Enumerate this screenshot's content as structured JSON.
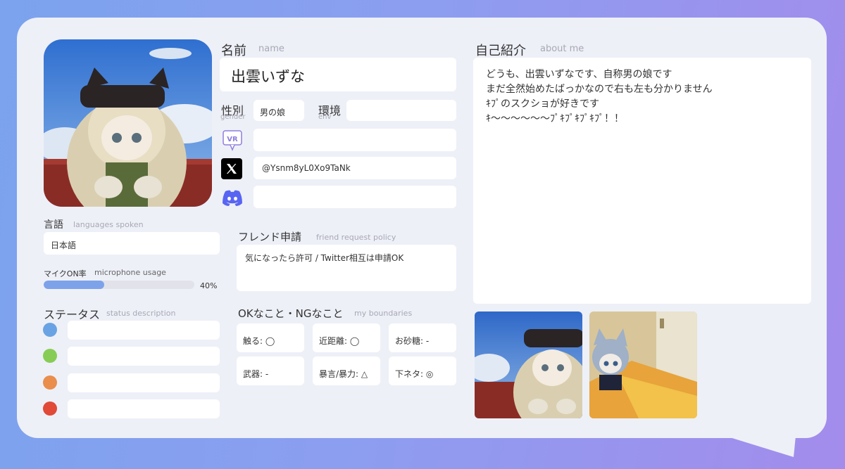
{
  "profile": {
    "name_label": "名前",
    "name_sub": "name",
    "name_value": "出雲いずな",
    "gender_label": "性別",
    "gender_sub": "gender",
    "gender_value": "男の娘",
    "env_label": "環境",
    "env_sub": "env",
    "env_value": "",
    "vrchat_value": "",
    "x_value": "@Ysnm8yL0Xo9TaNk",
    "discord_value": ""
  },
  "languages": {
    "label": "言語",
    "sub": "languages spoken",
    "value": "日本語"
  },
  "mic": {
    "label": "マイクON率",
    "sub": "microphone usage",
    "percent_text": "40%",
    "percent": 40
  },
  "status": {
    "label": "ステータス",
    "sub": "status description",
    "items": [
      {
        "color": "#6aa3e4",
        "text": ""
      },
      {
        "color": "#87cd55",
        "text": ""
      },
      {
        "color": "#e98e4d",
        "text": ""
      },
      {
        "color": "#e04a37",
        "text": ""
      }
    ]
  },
  "friend": {
    "label": "フレンド申請",
    "sub": "friend request policy",
    "value": "気になったら許可 / Twitter相互は申請OK"
  },
  "boundaries": {
    "label": "OKなこと・NGなこと",
    "sub": "my boundaries",
    "items": [
      "触る: ◯",
      "近距離: ◯",
      "お砂糖: -",
      "武器: -",
      "暴言/暴力: △",
      "下ネタ: ◎"
    ]
  },
  "about": {
    "label": "自己紹介",
    "sub": "about me",
    "lines": [
      "どうも、出雲いずなです、自称男の娘です",
      "まだ全然始めたばっかなので右も左も分かりません",
      "ｷﾌﾟのスクショが好きです",
      "ｷ〜〜〜〜〜〜ﾌﾟｷﾌﾟｷﾌﾟｷﾌﾟ！！"
    ]
  },
  "colors": {
    "accent": "#7ea2ea",
    "card": "#eef0f8"
  }
}
